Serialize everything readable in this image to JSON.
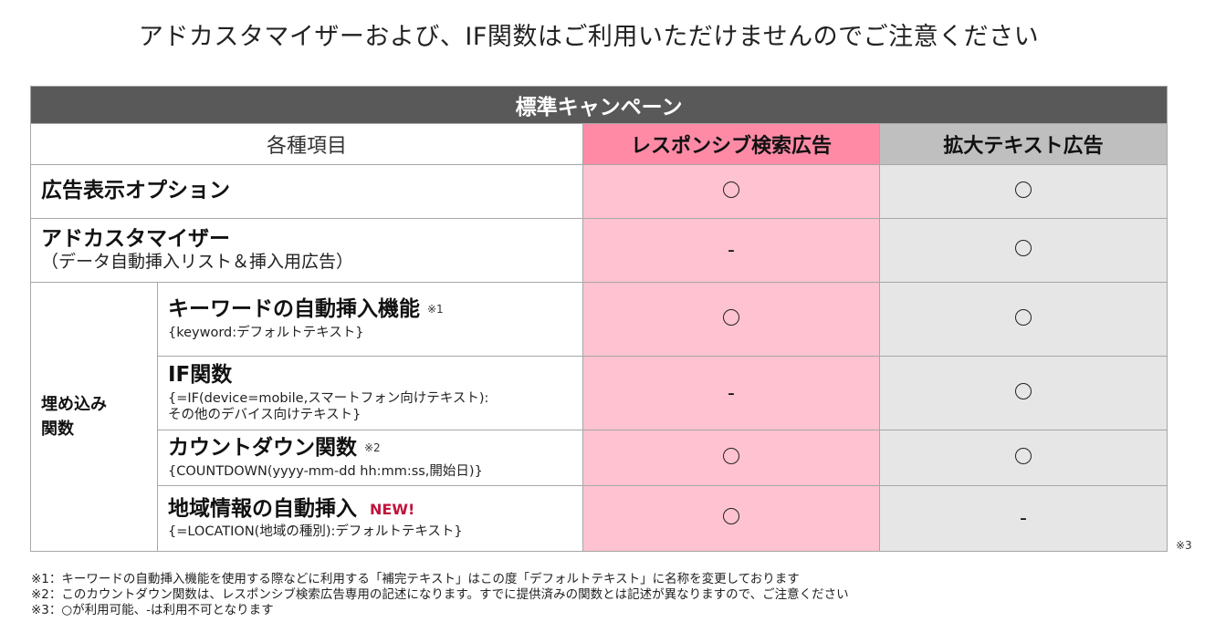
{
  "title": "アドカスタマイザーおよび、IF関数はご利用いただけませんのでご注意ください",
  "table": {
    "campaign_header": "標準キャンペーン",
    "items_header": "各種項目",
    "col_rsa_header": "レスポンシブ検索広告",
    "col_eta_header": "拡大テキスト広告",
    "rows": {
      "ad_extensions": {
        "label": "広告表示オプション",
        "rsa": "○",
        "eta": "○"
      },
      "ad_customizer": {
        "label": "アドカスタマイザー",
        "sub": "（データ自動挿入リスト＆挿入用広告）",
        "rsa": "-",
        "eta": "○"
      }
    },
    "embed_group_label_line1": "埋め込み",
    "embed_group_label_line2": "関数",
    "embed_rows": {
      "keyword_insertion": {
        "label": "キーワードの自動挿入機能",
        "note": "※1",
        "code": "{keyword:デフォルトテキスト}",
        "rsa": "○",
        "eta": "○"
      },
      "if_function": {
        "label": "IF関数",
        "code_line1": "{=IF(device=mobile,スマートフォン向けテキスト):",
        "code_line2": "その他のデバイス向けテキスト}",
        "rsa": "-",
        "eta": "○"
      },
      "countdown": {
        "label": "カウントダウン関数",
        "note": "※2",
        "code": "{COUNTDOWN(yyyy-mm-dd hh:mm:ss,開始日)}",
        "rsa": "○",
        "eta": "○"
      },
      "location_insertion": {
        "label": "地域情報の自動挿入",
        "badge": "NEW!",
        "code": "{=LOCATION(地域の種別):デフォルトテキスト}",
        "rsa": "○",
        "eta": "-"
      }
    }
  },
  "side_note": "※3",
  "footnotes": {
    "n1": "※1：キーワードの自動挿入機能を使用する際などに利用する「補完テキスト」はこの度「デフォルトテキスト」に名称を変更しております",
    "n2": "※2：このカウントダウン関数は、レスポンシブ検索広告専用の記述になります。すでに提供済みの関数とは記述が異なりますので、ご注意ください",
    "n3": "※3：○が利用可能、-は利用不可となります"
  },
  "colors": {
    "header_dark": "#595959",
    "rsa_header": "#ff8aa6",
    "rsa_cell": "#ffc2d0",
    "eta_header": "#bfbfbf",
    "eta_cell": "#e6e6e6",
    "new_badge": "#c0143c"
  }
}
